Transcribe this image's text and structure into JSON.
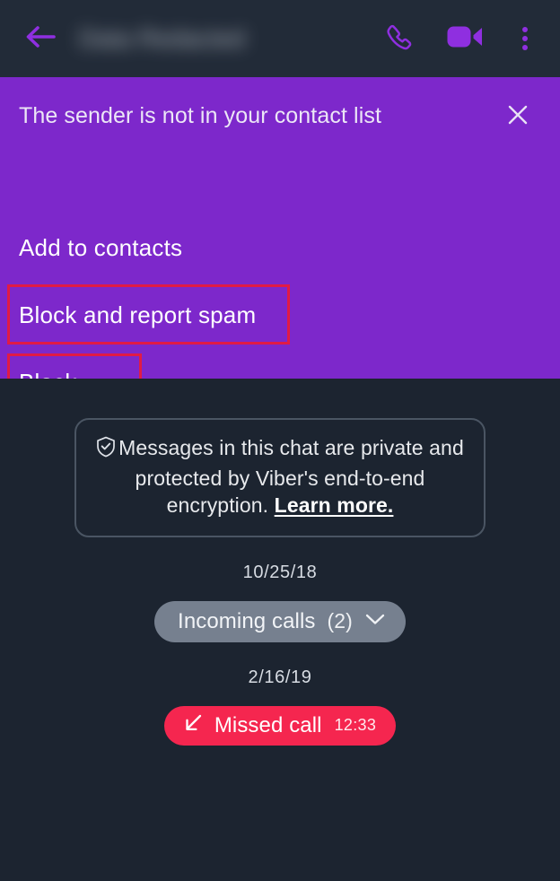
{
  "header": {
    "back_icon": "back-arrow-icon",
    "contact_name": "Data Redacted",
    "call_icon": "phone-call-icon",
    "video_icon": "video-camera-icon",
    "menu_icon": "overflow-menu-icon"
  },
  "spam_banner": {
    "title": "The sender is not in your contact list",
    "close_icon": "close-icon",
    "options": {
      "add_to_contacts": "Add to contacts",
      "block_and_report_spam": "Block and report spam",
      "block": "Block"
    },
    "background_color": "#7d28cb",
    "annotation_color": "#e01b46"
  },
  "chat": {
    "encryption_notice": {
      "shield_icon": "shield-check-icon",
      "text": "Messages in this chat are private and protected by Viber's end-to-end encryption.",
      "link": "Learn more."
    },
    "entries": [
      {
        "date": "10/25/18",
        "type": "incoming_calls",
        "label": "Incoming calls",
        "count": "(2)",
        "expand_icon": "chevron-down-icon",
        "color": "#76808f"
      },
      {
        "date": "2/16/19",
        "type": "missed_call",
        "direction_icon": "arrow-down-left-icon",
        "label": "Missed call",
        "time": "12:33",
        "color": "#f5264f"
      }
    ]
  },
  "theme": {
    "background": "#1c2430",
    "header_background": "#222b38",
    "accent_purple": "#8f2fe0"
  }
}
